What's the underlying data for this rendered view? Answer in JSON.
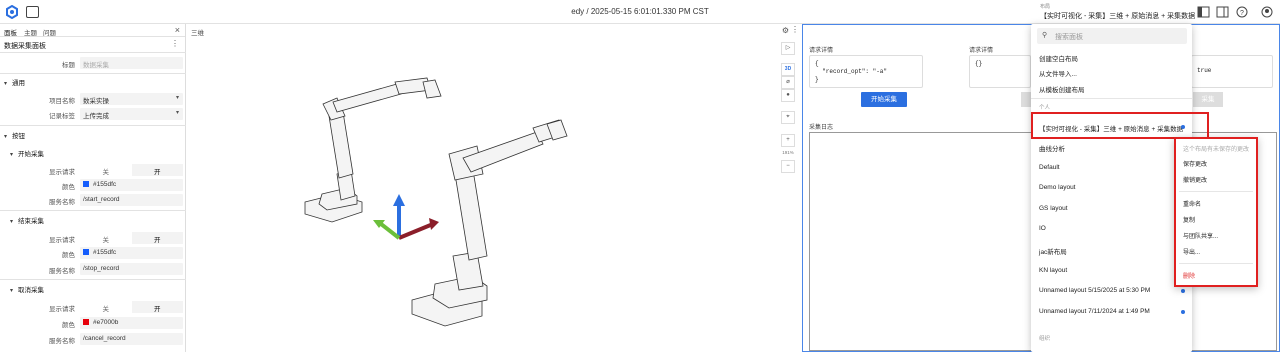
{
  "topbar": {
    "title": "edy / 2025-05-15 6:01:01.330 PM CST",
    "layout_header": "布局",
    "layout_value": "【实时可视化 - 采集】三维 + 原始消息 + 采集数据",
    "chev": "⌄"
  },
  "left": {
    "tabs": [
      "面板",
      "主题",
      "问题"
    ],
    "close": "×",
    "panel_title": "数据采集面板",
    "menu": "⋮",
    "title_label": "标题",
    "title_placeholder": "数据采集",
    "general": "通用",
    "project_label": "项目名称",
    "project_value": "数采实操",
    "status_label": "记录标签",
    "status_value": "上传完成",
    "buttons_section": "按钮",
    "groups": [
      {
        "name": "开始采集",
        "show_label": "显示请求",
        "off": "关",
        "on": "开",
        "color_label": "颜色",
        "color": "#155dfc",
        "service_label": "服务名称",
        "service": "/start_record"
      },
      {
        "name": "结束采集",
        "show_label": "显示请求",
        "off": "关",
        "on": "开",
        "color_label": "颜色",
        "color": "#155dfc",
        "service_label": "服务名称",
        "service": "/stop_record"
      },
      {
        "name": "取消采集",
        "show_label": "显示请求",
        "off": "关",
        "on": "开",
        "color_label": "颜色",
        "color": "#e7000b",
        "service_label": "服务名称",
        "service": "/cancel_record"
      }
    ]
  },
  "viewer": {
    "title": "三维",
    "mode_3d": "3D",
    "zoom": "191%",
    "plus": "+",
    "minus": "−"
  },
  "right": {
    "req_label_1": "请求详情",
    "req_label_2": "请求详情",
    "code_1": "{\n  \"record_opt\": \"-a\"\n}",
    "code_2": "{}",
    "code_3": "true",
    "start_btn": "开始采集",
    "ghost_btn_2": "采集",
    "log_label": "采集日志"
  },
  "dropdown": {
    "search_placeholder": "搜索面板",
    "create": "创建空白布局",
    "import": "从文件导入...",
    "from_template": "从模板创建布局",
    "personal": "个人",
    "current": "【实时可视化 - 采集】三维 + 原始消息 + 采集数据",
    "items": [
      "曲线分析",
      "Default",
      "Demo layout",
      "GS layout",
      "IO",
      "jac新布局",
      "KN layout",
      "Unnamed layout 5/15/2025 at 5:30 PM",
      "Unnamed layout 7/11/2024 at 1:49 PM"
    ],
    "org": "组织"
  },
  "submenu": {
    "note": "这个布局有未保存的更改",
    "save": "保存更改",
    "revert": "撤销更改",
    "rename": "重命名",
    "duplicate": "复制",
    "share": "与团队共享...",
    "export": "导出...",
    "delete": "删除"
  },
  "colors": {
    "accent": "#2b6fe0",
    "highlight": "#e02020"
  }
}
